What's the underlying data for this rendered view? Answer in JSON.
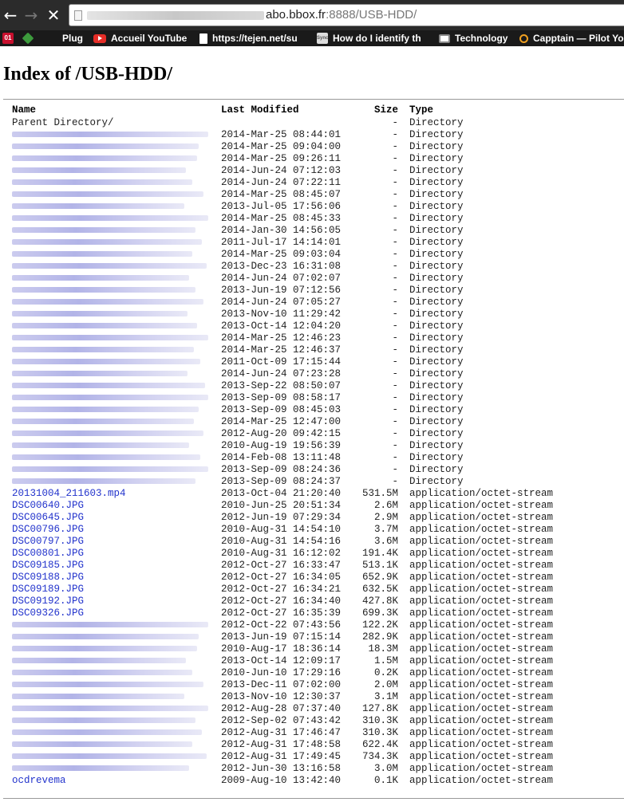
{
  "browser": {
    "url_host": "abo.bbox.fr",
    "url_port": ":8888",
    "url_path": "/USB-HDD/",
    "bookmarks": [
      {
        "label": "",
        "icon": "01net-icon"
      },
      {
        "label": "",
        "icon": "feedly-icon"
      },
      {
        "label": "Plug",
        "icon": ""
      },
      {
        "label": "Accueil YouTube",
        "icon": "youtube-icon"
      },
      {
        "label": "https://tejen.net/su",
        "icon": "page-icon"
      },
      {
        "label": "How do I identify th",
        "icon": "sync-icon"
      },
      {
        "label": "Technology",
        "icon": "monitor-icon"
      },
      {
        "label": "Capptain — Pilot Yo",
        "icon": "capptain-icon"
      }
    ]
  },
  "page": {
    "title": "Index of /USB-HDD/",
    "columns": {
      "name": "Name",
      "modified": "Last Modified",
      "size": "Size",
      "type": "Type"
    },
    "parent": {
      "name": "Parent Directory/",
      "size": "-",
      "type": "Directory"
    }
  },
  "rows": [
    {
      "name": "",
      "modified": "2014-Mar-25 08:44:01",
      "size": "-",
      "type": "Directory"
    },
    {
      "name": "",
      "modified": "2014-Mar-25 09:04:00",
      "size": "-",
      "type": "Directory"
    },
    {
      "name": "",
      "modified": "2014-Mar-25 09:26:11",
      "size": "-",
      "type": "Directory"
    },
    {
      "name": "",
      "modified": "2014-Jun-24 07:12:03",
      "size": "-",
      "type": "Directory"
    },
    {
      "name": "",
      "modified": "2014-Jun-24 07:22:11",
      "size": "-",
      "type": "Directory"
    },
    {
      "name": "",
      "modified": "2014-Mar-25 08:45:07",
      "size": "-",
      "type": "Directory"
    },
    {
      "name": "",
      "modified": "2013-Jul-05 17:56:06",
      "size": "-",
      "type": "Directory"
    },
    {
      "name": "",
      "modified": "2014-Mar-25 08:45:33",
      "size": "-",
      "type": "Directory"
    },
    {
      "name": "",
      "modified": "2014-Jan-30 14:56:05",
      "size": "-",
      "type": "Directory"
    },
    {
      "name": "",
      "modified": "2011-Jul-17 14:14:01",
      "size": "-",
      "type": "Directory"
    },
    {
      "name": "",
      "modified": "2014-Mar-25 09:03:04",
      "size": "-",
      "type": "Directory"
    },
    {
      "name": "",
      "modified": "2013-Dec-23 16:31:08",
      "size": "-",
      "type": "Directory"
    },
    {
      "name": "",
      "modified": "2014-Jun-24 07:02:07",
      "size": "-",
      "type": "Directory"
    },
    {
      "name": "",
      "modified": "2013-Jun-19 07:12:56",
      "size": "-",
      "type": "Directory"
    },
    {
      "name": "",
      "modified": "2014-Jun-24 07:05:27",
      "size": "-",
      "type": "Directory"
    },
    {
      "name": "",
      "modified": "2013-Nov-10 11:29:42",
      "size": "-",
      "type": "Directory"
    },
    {
      "name": "",
      "modified": "2013-Oct-14 12:04:20",
      "size": "-",
      "type": "Directory"
    },
    {
      "name": "",
      "modified": "2014-Mar-25 12:46:23",
      "size": "-",
      "type": "Directory"
    },
    {
      "name": "",
      "modified": "2014-Mar-25 12:46:37",
      "size": "-",
      "type": "Directory"
    },
    {
      "name": "",
      "modified": "2011-Oct-09 17:15:44",
      "size": "-",
      "type": "Directory"
    },
    {
      "name": "",
      "modified": "2014-Jun-24 07:23:28",
      "size": "-",
      "type": "Directory"
    },
    {
      "name": "",
      "modified": "2013-Sep-22 08:50:07",
      "size": "-",
      "type": "Directory"
    },
    {
      "name": "",
      "modified": "2013-Sep-09 08:58:17",
      "size": "-",
      "type": "Directory"
    },
    {
      "name": "",
      "modified": "2013-Sep-09 08:45:03",
      "size": "-",
      "type": "Directory"
    },
    {
      "name": "",
      "modified": "2014-Mar-25 12:47:00",
      "size": "-",
      "type": "Directory"
    },
    {
      "name": "",
      "modified": "2012-Aug-20 09:42:15",
      "size": "-",
      "type": "Directory"
    },
    {
      "name": "",
      "modified": "2010-Aug-19 19:56:39",
      "size": "-",
      "type": "Directory"
    },
    {
      "name": "",
      "modified": "2014-Feb-08 13:11:48",
      "size": "-",
      "type": "Directory"
    },
    {
      "name": "",
      "modified": "2013-Sep-09 08:24:36",
      "size": "-",
      "type": "Directory"
    },
    {
      "name": "",
      "modified": "2013-Sep-09 08:24:37",
      "size": "-",
      "type": "Directory"
    },
    {
      "name": "20131004_211603.mp4",
      "modified": "2013-Oct-04 21:20:40",
      "size": "531.5M",
      "type": "application/octet-stream"
    },
    {
      "name": "DSC00640.JPG",
      "modified": "2010-Jun-25 20:51:34",
      "size": "2.6M",
      "type": "application/octet-stream"
    },
    {
      "name": "DSC00645.JPG",
      "modified": "2012-Jun-19 07:29:34",
      "size": "2.9M",
      "type": "application/octet-stream"
    },
    {
      "name": "DSC00796.JPG",
      "modified": "2010-Aug-31 14:54:10",
      "size": "3.7M",
      "type": "application/octet-stream"
    },
    {
      "name": "DSC00797.JPG",
      "modified": "2010-Aug-31 14:54:16",
      "size": "3.6M",
      "type": "application/octet-stream"
    },
    {
      "name": "DSC00801.JPG",
      "modified": "2010-Aug-31 16:12:02",
      "size": "191.4K",
      "type": "application/octet-stream"
    },
    {
      "name": "DSC09185.JPG",
      "modified": "2012-Oct-27 16:33:47",
      "size": "513.1K",
      "type": "application/octet-stream"
    },
    {
      "name": "DSC09188.JPG",
      "modified": "2012-Oct-27 16:34:05",
      "size": "652.9K",
      "type": "application/octet-stream"
    },
    {
      "name": "DSC09189.JPG",
      "modified": "2012-Oct-27 16:34:21",
      "size": "632.5K",
      "type": "application/octet-stream"
    },
    {
      "name": "DSC09192.JPG",
      "modified": "2012-Oct-27 16:34:40",
      "size": "427.8K",
      "type": "application/octet-stream"
    },
    {
      "name": "DSC09326.JPG",
      "modified": "2012-Oct-27 16:35:39",
      "size": "699.3K",
      "type": "application/octet-stream"
    },
    {
      "name": "",
      "modified": "2012-Oct-22 07:43:56",
      "size": "122.2K",
      "type": "application/octet-stream"
    },
    {
      "name": "",
      "modified": "2013-Jun-19 07:15:14",
      "size": "282.9K",
      "type": "application/octet-stream"
    },
    {
      "name": "",
      "modified": "2010-Aug-17 18:36:14",
      "size": "18.3M",
      "type": "application/octet-stream"
    },
    {
      "name": "",
      "modified": "2013-Oct-14 12:09:17",
      "size": "1.5M",
      "type": "application/octet-stream"
    },
    {
      "name": "",
      "modified": "2010-Jun-10 17:29:16",
      "size": "0.2K",
      "type": "application/octet-stream"
    },
    {
      "name": "",
      "modified": "2013-Dec-11 07:02:00",
      "size": "2.0M",
      "type": "application/octet-stream"
    },
    {
      "name": "",
      "modified": "2013-Nov-10 12:30:37",
      "size": "3.1M",
      "type": "application/octet-stream"
    },
    {
      "name": "",
      "modified": "2012-Aug-28 07:37:40",
      "size": "127.8K",
      "type": "application/octet-stream"
    },
    {
      "name": "",
      "modified": "2012-Sep-02 07:43:42",
      "size": "310.3K",
      "type": "application/octet-stream"
    },
    {
      "name": "",
      "modified": "2012-Aug-31 17:46:47",
      "size": "310.3K",
      "type": "application/octet-stream"
    },
    {
      "name": "",
      "modified": "2012-Aug-31 17:48:58",
      "size": "622.4K",
      "type": "application/octet-stream"
    },
    {
      "name": "",
      "modified": "2012-Aug-31 17:49:45",
      "size": "734.3K",
      "type": "application/octet-stream"
    },
    {
      "name": "",
      "modified": "2012-Jun-30 13:16:58",
      "size": "3.0M",
      "type": "application/octet-stream"
    },
    {
      "name": "ocdrevema",
      "modified": "2009-Aug-10 13:42:40",
      "size": "0.1K",
      "type": "application/octet-stream"
    }
  ]
}
